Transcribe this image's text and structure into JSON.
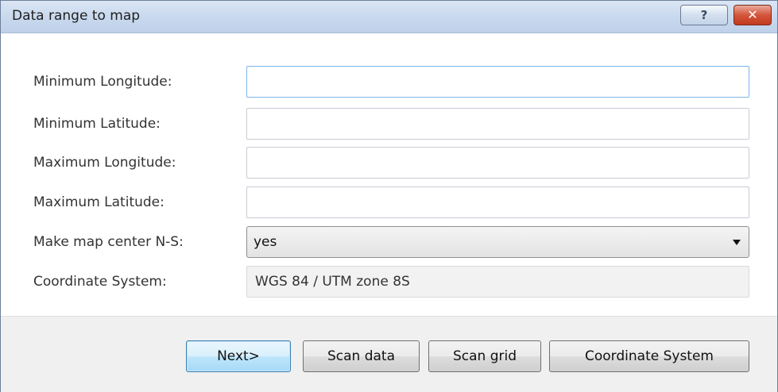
{
  "window": {
    "title": "Data range to map",
    "help_label": "?",
    "close_label": "✕"
  },
  "form": {
    "min_longitude": {
      "label": "Minimum Longitude:",
      "value": ""
    },
    "min_latitude": {
      "label": "Minimum Latitude:",
      "value": ""
    },
    "max_longitude": {
      "label": "Maximum Longitude:",
      "value": ""
    },
    "max_latitude": {
      "label": "Maximum Latitude:",
      "value": ""
    },
    "map_center": {
      "label": "Make map center N-S:",
      "selected": "yes"
    },
    "coordinate_system": {
      "label": "Coordinate System:",
      "value": "WGS 84 / UTM zone 8S"
    }
  },
  "buttons": {
    "next": "Next>",
    "scan_data": "Scan data",
    "scan_grid": "Scan grid",
    "coordinate_system": "Coordinate System"
  },
  "icons": {
    "help": "help-icon",
    "close": "close-icon",
    "dropdown": "chevron-down-icon"
  }
}
